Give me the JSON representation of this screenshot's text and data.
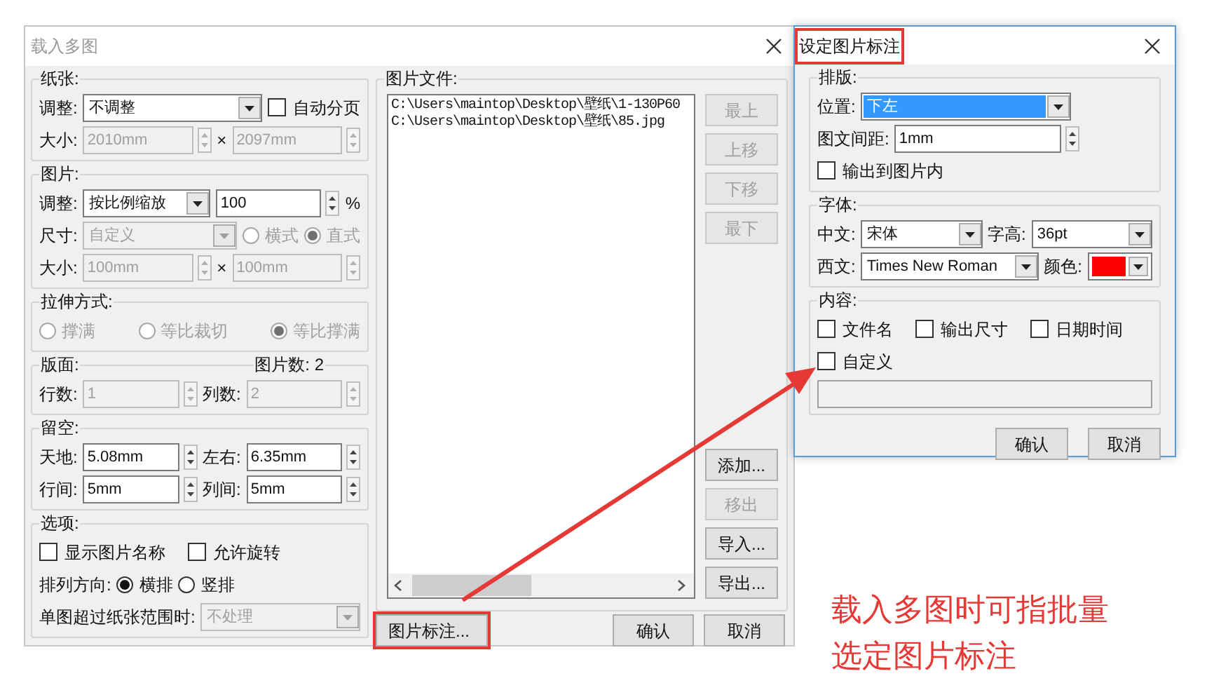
{
  "main_dialog": {
    "title": "载入多图",
    "groups": [
      {
        "legend": "纸张:",
        "rows": [
          {
            "controls": [
              {
                "kind": "label",
                "text": "调整:",
                "disabled": false
              },
              {
                "kind": "dropdown",
                "value": "不调整",
                "disabled": false,
                "highlighted": false
              },
              {
                "kind": "checkbox",
                "label": "自动分页",
                "checked": false,
                "disabled": false
              }
            ]
          },
          {
            "controls": [
              {
                "kind": "label",
                "text": "大小:",
                "disabled": false
              },
              {
                "kind": "spin",
                "value": "2010mm",
                "disabled": true
              },
              {
                "kind": "label",
                "text": "×",
                "disabled": false
              },
              {
                "kind": "spin",
                "value": "2097mm",
                "disabled": true
              }
            ]
          }
        ]
      },
      {
        "legend": "图片:",
        "rows": [
          {
            "controls": [
              {
                "kind": "label",
                "text": "调整:",
                "disabled": false
              },
              {
                "kind": "dropdown",
                "value": "按比例缩放",
                "disabled": false,
                "highlighted": false
              },
              {
                "kind": "spin",
                "value": "100",
                "disabled": false
              },
              {
                "kind": "label",
                "text": "%",
                "disabled": false
              }
            ]
          },
          {
            "controls": [
              {
                "kind": "label",
                "text": "尺寸:",
                "disabled": false
              },
              {
                "kind": "dropdown",
                "value": "自定义",
                "disabled": true,
                "highlighted": false
              },
              {
                "kind": "radio",
                "label": "横式",
                "selected": false,
                "disabled": true
              },
              {
                "kind": "radio",
                "label": "直式",
                "selected": true,
                "disabled": true
              }
            ]
          },
          {
            "controls": [
              {
                "kind": "label",
                "text": "大小:",
                "disabled": false
              },
              {
                "kind": "spin",
                "value": "100mm",
                "disabled": true
              },
              {
                "kind": "label",
                "text": "×",
                "disabled": false
              },
              {
                "kind": "spin",
                "value": "100mm",
                "disabled": true
              }
            ]
          }
        ]
      },
      {
        "legend": "拉伸方式:",
        "rows": [
          {
            "controls": [
              {
                "kind": "radio",
                "label": "撑满",
                "selected": false,
                "disabled": true
              },
              {
                "kind": "radio",
                "label": "等比裁切",
                "selected": false,
                "disabled": true
              },
              {
                "kind": "radio",
                "label": "等比撑满",
                "selected": true,
                "disabled": true
              }
            ]
          }
        ]
      },
      {
        "legend": "版面:",
        "legend_right": "图片数: 2",
        "rows": [
          {
            "controls": [
              {
                "kind": "label",
                "text": "行数:",
                "disabled": false
              },
              {
                "kind": "spin",
                "value": "1",
                "disabled": true
              },
              {
                "kind": "label",
                "text": "列数:",
                "disabled": false
              },
              {
                "kind": "spin",
                "value": "2",
                "disabled": true
              }
            ]
          }
        ]
      },
      {
        "legend": "留空:",
        "rows": [
          {
            "controls": [
              {
                "kind": "label",
                "text": "天地:",
                "disabled": false
              },
              {
                "kind": "spin",
                "value": "5.08mm",
                "disabled": false
              },
              {
                "kind": "label",
                "text": "左右:",
                "disabled": false
              },
              {
                "kind": "spin",
                "value": "6.35mm",
                "disabled": false
              }
            ]
          },
          {
            "controls": [
              {
                "kind": "label",
                "text": "行间:",
                "disabled": false
              },
              {
                "kind": "spin",
                "value": "5mm",
                "disabled": false
              },
              {
                "kind": "label",
                "text": "列间:",
                "disabled": false
              },
              {
                "kind": "spin",
                "value": "5mm",
                "disabled": false
              }
            ]
          }
        ]
      },
      {
        "legend": "选项:",
        "rows": [
          {
            "controls": [
              {
                "kind": "checkbox",
                "label": "显示图片名称",
                "checked": false,
                "disabled": false
              },
              {
                "kind": "checkbox",
                "label": "允许旋转",
                "checked": false,
                "disabled": false
              }
            ]
          },
          {
            "controls": [
              {
                "kind": "label",
                "text": "排列方向:",
                "disabled": false
              },
              {
                "kind": "radio",
                "label": "横排",
                "selected": true,
                "disabled": false
              },
              {
                "kind": "radio",
                "label": "竖排",
                "selected": false,
                "disabled": false
              }
            ]
          },
          {
            "controls": [
              {
                "kind": "label",
                "text": "单图超过纸张范围时:",
                "disabled": false
              },
              {
                "kind": "dropdown",
                "value": "不处理",
                "disabled": true,
                "highlighted": false
              }
            ]
          }
        ]
      }
    ],
    "files": {
      "legend": "图片文件:",
      "items": [
        "C:\\Users\\maintop\\Desktop\\壁纸\\1-130P60",
        "C:\\Users\\maintop\\Desktop\\壁纸\\85.jpg"
      ],
      "button_groups": [
        [
          {
            "label": "最上",
            "disabled": true
          },
          {
            "label": "上移",
            "disabled": true
          },
          {
            "label": "下移",
            "disabled": true
          },
          {
            "label": "最下",
            "disabled": true
          }
        ],
        [
          {
            "label": "添加...",
            "disabled": false
          },
          {
            "label": "移出",
            "disabled": true
          },
          {
            "label": "导入...",
            "disabled": false
          },
          {
            "label": "导出...",
            "disabled": false
          }
        ]
      ]
    },
    "label_button": {
      "label": "图片标注...",
      "highlighted": true
    },
    "buttons": [
      {
        "label": "确认"
      },
      {
        "label": "取消"
      }
    ]
  },
  "label_dialog": {
    "title": "设定图片标注",
    "title_highlighted": true,
    "groups": [
      {
        "legend": "排版:",
        "rows": [
          {
            "controls": [
              {
                "kind": "label",
                "text": "位置:",
                "disabled": false
              },
              {
                "kind": "dropdown",
                "value": "下左",
                "disabled": false,
                "highlighted": true
              }
            ]
          },
          {
            "controls": [
              {
                "kind": "label",
                "text": "图文间距:",
                "disabled": false
              },
              {
                "kind": "spin",
                "value": "1mm",
                "disabled": false
              }
            ]
          },
          {
            "controls": [
              {
                "kind": "checkbox",
                "label": "输出到图片内",
                "checked": false,
                "disabled": false
              }
            ]
          }
        ]
      },
      {
        "legend": "字体:",
        "rows": [
          {
            "controls": [
              {
                "kind": "label",
                "text": "中文:",
                "disabled": false
              },
              {
                "kind": "dropdown",
                "value": "宋体",
                "disabled": false,
                "highlighted": false
              },
              {
                "kind": "label",
                "text": "字高:",
                "disabled": false
              },
              {
                "kind": "dropdown",
                "value": "36pt",
                "disabled": false,
                "highlighted": false
              }
            ]
          },
          {
            "controls": [
              {
                "kind": "label",
                "text": "西文:",
                "disabled": false
              },
              {
                "kind": "dropdown",
                "value": "Times New Roman",
                "disabled": false,
                "highlighted": false
              },
              {
                "kind": "label",
                "text": "颜色:",
                "disabled": false
              },
              {
                "kind": "color_picker",
                "color": "#ff0000"
              }
            ]
          }
        ]
      },
      {
        "legend": "内容:",
        "rows": [
          {
            "controls": [
              {
                "kind": "checkbox",
                "label": "文件名",
                "checked": false,
                "disabled": false
              },
              {
                "kind": "checkbox",
                "label": "输出尺寸",
                "checked": false,
                "disabled": false
              },
              {
                "kind": "checkbox",
                "label": "日期时间",
                "checked": false,
                "disabled": false
              }
            ]
          },
          {
            "controls": [
              {
                "kind": "checkbox",
                "label": "自定义",
                "checked": false,
                "disabled": false
              }
            ]
          },
          {
            "controls": [
              {
                "kind": "text_field",
                "disabled": true
              }
            ]
          }
        ]
      }
    ],
    "buttons": [
      {
        "label": "确认"
      },
      {
        "label": "取消"
      }
    ]
  },
  "annotation": {
    "text": "载入多图时可指批量选定图片标注"
  }
}
